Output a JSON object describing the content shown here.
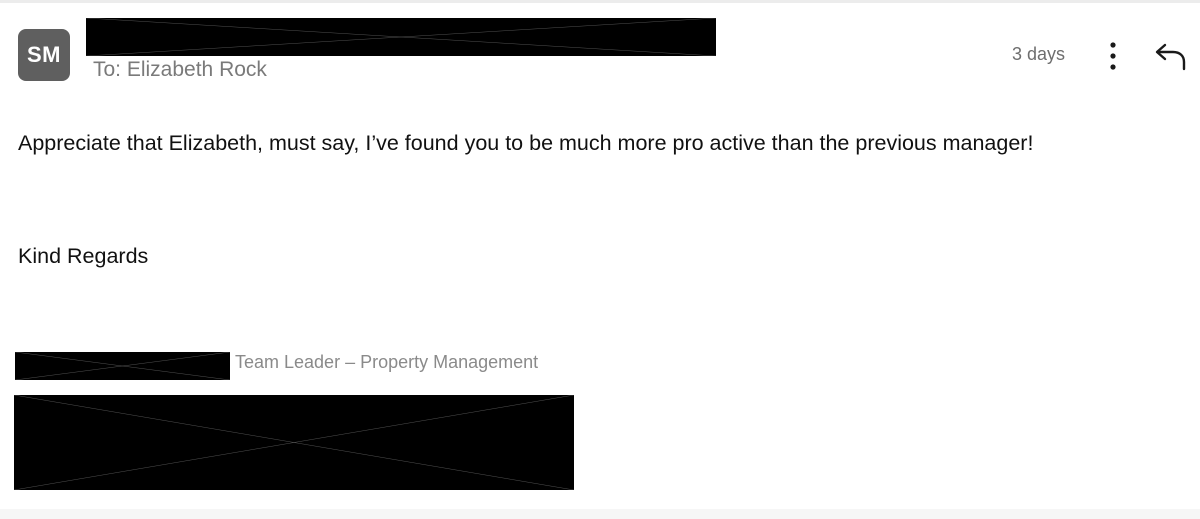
{
  "sender": {
    "avatar_initials": "SM",
    "to_line": "To: Elizabeth Rock"
  },
  "meta": {
    "date": "3 days",
    "more_icon": "more-vertical-icon",
    "reply_icon": "reply-icon"
  },
  "message": {
    "body": "Appreciate that Elizabeth, must say, I’ve found you to be much more pro active than the previous manager!",
    "signoff": "Kind Regards"
  },
  "signature": {
    "title": "Team Leader – Property Management"
  },
  "colors": {
    "avatar_bg": "#5f5f5f",
    "redaction": "#000000",
    "muted_text": "#7a7a7a"
  }
}
